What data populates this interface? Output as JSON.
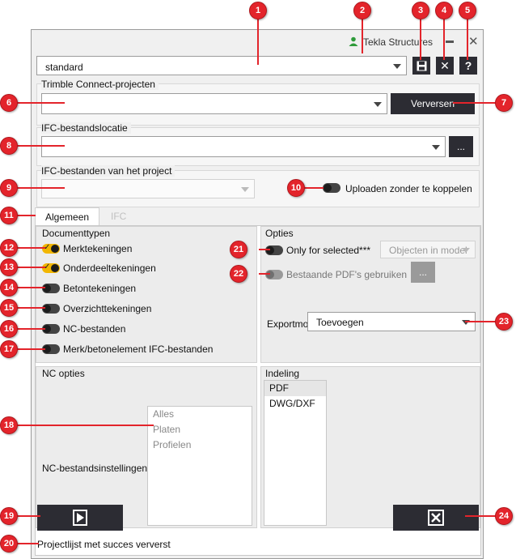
{
  "window": {
    "title": "Tekla Structures"
  },
  "settings": {
    "value": "standard"
  },
  "toolbar": {
    "save_icon": "save-icon",
    "close_icon": "close-icon",
    "help_label": "?"
  },
  "trimble": {
    "label": "Trimble Connect-projecten",
    "value": "",
    "refresh_label": "Verversen"
  },
  "ifc_location": {
    "label": "IFC-bestandslocatie",
    "value": "",
    "browse_label": "..."
  },
  "project_ifc": {
    "label": "IFC-bestanden van het project",
    "value": "",
    "upload_label": "Uploaden zonder te koppelen"
  },
  "tabs": [
    {
      "label": "Algemeen"
    },
    {
      "label": "IFC"
    }
  ],
  "document_types": {
    "title": "Documenttypen",
    "items": [
      {
        "label": "Merktekeningen",
        "on": true
      },
      {
        "label": "Onderdeeltekeningen",
        "on": true
      },
      {
        "label": "Betontekeningen",
        "on": false
      },
      {
        "label": "Overzichttekeningen",
        "on": false
      },
      {
        "label": "NC-bestanden",
        "on": false
      },
      {
        "label": "Merk/betonelement IFC-bestanden",
        "on": false
      }
    ]
  },
  "options": {
    "title": "Opties",
    "only_selected_label": "Only for selected***",
    "objects_value": "Objecten in model",
    "existing_pdf_label": "Bestaande PDF's gebruiken",
    "existing_pdf_browse": "...",
    "export_mode_label": "Exportmodus",
    "export_mode_value": "Toevoegen"
  },
  "nc_options": {
    "title": "NC opties",
    "settings_label": "NC-bestandsinstellingen",
    "items": [
      "Alles",
      "Platen",
      "Profielen"
    ]
  },
  "layout": {
    "title": "Indeling",
    "items": [
      "PDF",
      "DWG/DXF"
    ]
  },
  "status": {
    "text": "Projectlijst met succes ververst"
  },
  "markers": [
    "1",
    "2",
    "3",
    "4",
    "5",
    "6",
    "7",
    "8",
    "9",
    "10",
    "11",
    "12",
    "13",
    "14",
    "15",
    "16",
    "17",
    "18",
    "19",
    "20",
    "21",
    "22",
    "23",
    "24"
  ],
  "colors": {
    "accent": "#f2b600",
    "dark_button": "#2c2c33",
    "marker": "#e3242b"
  }
}
